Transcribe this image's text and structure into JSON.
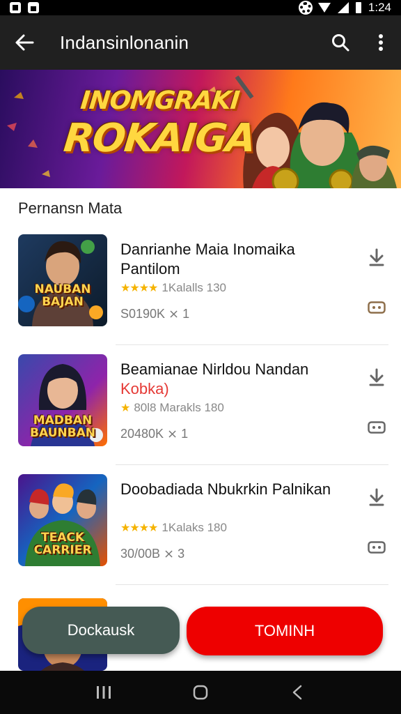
{
  "status_bar": {
    "time": "1:24"
  },
  "app_bar": {
    "title": "Indansinlonanin"
  },
  "banner": {
    "line1": "INOMGRAKI",
    "line2": "ROKAIGA"
  },
  "section": {
    "title": "Pernansn Mata"
  },
  "items": [
    {
      "title": "Danrianhe Maia Inomaika Pantilom",
      "subtitle": "",
      "stars": "★★★★",
      "rating_text": "1Kalalls 130",
      "meta": "S0190K ⨯ 1",
      "thumb_text": "NAUBAN BAJAN"
    },
    {
      "title": "Beamianae Nirldou Nandan",
      "subtitle": "Kobka)",
      "stars": "★",
      "rating_text": "80l8 Marakls 180",
      "meta": "20480K ⨯ 1",
      "thumb_text": "MADBAN BAUNBAN"
    },
    {
      "title": "Doobadiada Nbukrkin Palnikan",
      "subtitle": "",
      "stars": "★★★★",
      "rating_text": "1Kalaks 180",
      "meta": "30/00B ⨯ 3",
      "thumb_text": "TEACK CARRIER"
    }
  ],
  "buttons": {
    "secondary": "Dockausk",
    "primary": "TOMINH"
  },
  "colors": {
    "appbar": "#202020",
    "primary_button": "#ee0000",
    "secondary_button": "#455a54",
    "star": "#f5b301"
  }
}
